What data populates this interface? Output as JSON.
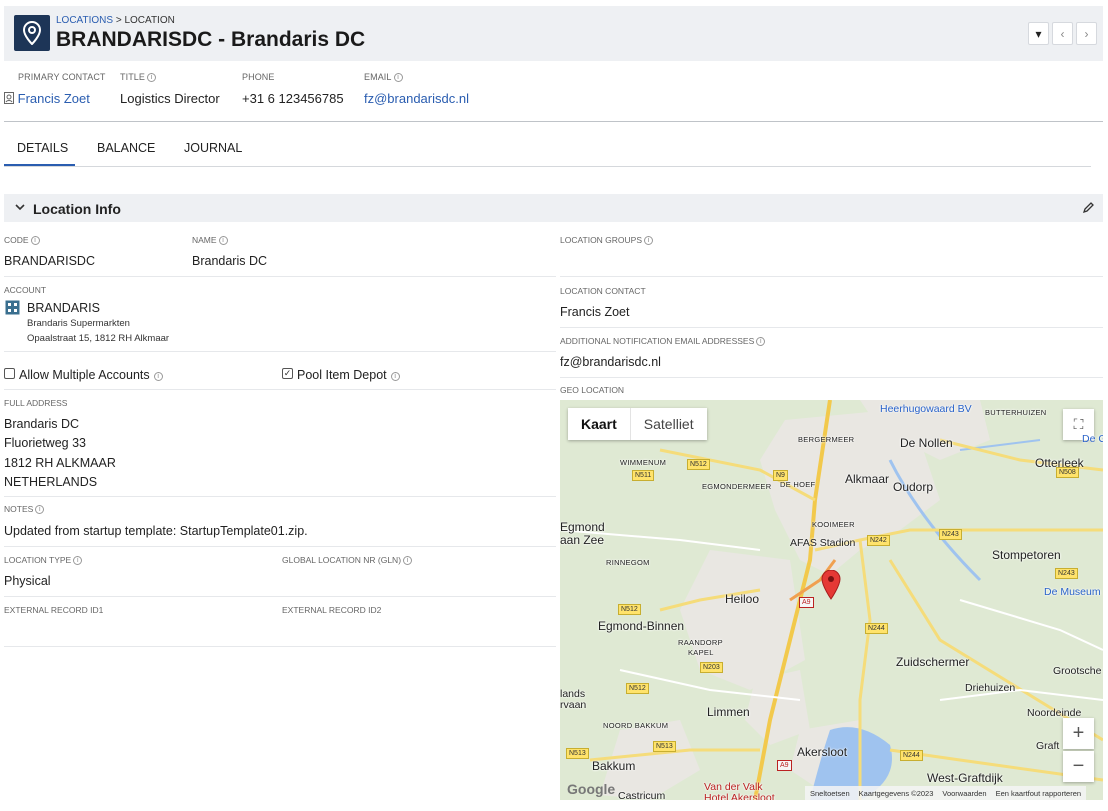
{
  "header": {
    "breadcrumb_link": "LOCATIONS",
    "breadcrumb_sep": " > ",
    "breadcrumb_current": "LOCATION",
    "title": "BRANDARISDC - Brandaris DC",
    "icon": "location-pin-icon"
  },
  "contact": {
    "primary_contact_label": "PRIMARY CONTACT",
    "primary_contact_value": "Francis Zoet",
    "title_label": "TITLE",
    "title_value": "Logistics Director",
    "phone_label": "PHONE",
    "phone_value": "+31 6 123456785",
    "email_label": "EMAIL",
    "email_value": "fz@brandarisdc.nl"
  },
  "tabs": [
    {
      "label": "DETAILS",
      "active": true
    },
    {
      "label": "BALANCE",
      "active": false
    },
    {
      "label": "JOURNAL",
      "active": false
    }
  ],
  "section": {
    "title": "Location Info"
  },
  "fields": {
    "code_label": "CODE",
    "code_value": "BRANDARISDC",
    "name_label": "NAME",
    "name_value": "Brandaris DC",
    "location_groups_label": "LOCATION GROUPS",
    "account_label": "ACCOUNT",
    "account_code": "BRANDARIS",
    "account_name": "Brandaris Supermarkten",
    "account_address": "Opaalstraat 15, 1812 RH Alkmaar",
    "location_contact_label": "LOCATION CONTACT",
    "location_contact_value": "Francis Zoet",
    "additional_email_label": "ADDITIONAL NOTIFICATION EMAIL ADDRESSES",
    "additional_email_value": "fz@brandarisdc.nl",
    "allow_multiple_label": "Allow Multiple Accounts",
    "allow_multiple_checked": false,
    "pool_item_label": "Pool Item Depot",
    "pool_item_checked": true,
    "geo_label": "GEO LOCATION",
    "full_address_label": "FULL ADDRESS",
    "address_line1": "Brandaris DC",
    "address_line2": "Fluorietweg 33",
    "address_line3": "1812 RH  ALKMAAR",
    "address_line4": "NETHERLANDS",
    "notes_label": "NOTES",
    "notes_value": "Updated from startup template: StartupTemplate01.zip.",
    "location_type_label": "LOCATION TYPE",
    "location_type_value": "Physical",
    "gln_label": "GLOBAL LOCATION NR (GLN)",
    "ext1_label": "EXTERNAL RECORD ID1",
    "ext2_label": "EXTERNAL RECORD ID2"
  },
  "map": {
    "toggle_map": "Kaart",
    "toggle_satellite": "Satelliet",
    "places": {
      "heerhugowaard": "Heerhugowaard BV",
      "butterhuizen": "BUTTERHUIZEN",
      "bergermeer": "BERGERMEER",
      "de_nollen": "De Nollen",
      "de_g": "De G",
      "wimmenum": "WIMMENUM",
      "egmondermeer": "EGMONDERMEER",
      "de_hoef": "DE HOEF",
      "alkmaar": "Alkmaar",
      "oudorp": "Oudorp",
      "otterleek": "Otterleek",
      "egmond": "Egmond",
      "aan_zee": "aan Zee",
      "kooimeer": "KOOIMEER",
      "afas": "AFAS Stadion",
      "stompetoren": "Stompetoren",
      "rinnegom": "RINNEGOM",
      "de_museum": "De Museum",
      "heiloo": "Heiloo",
      "egmond_binnen": "Egmond-Binnen",
      "raandorp": "RAANDORP",
      "kapel": "KAPEL",
      "zuidschermer": "Zuidschermer",
      "grootsche": "Grootsche",
      "driehuizen": "Driehuizen",
      "lands": "lands",
      "rvaan": "rvaan",
      "limmen": "Limmen",
      "noordeinde": "Noordeinde",
      "noord_bakkum": "NOORD BAKKUM",
      "graft": "Graft",
      "akersloot": "Akersloot",
      "bakkum": "Bakkum",
      "west_graftdijk": "West-Graftdijk",
      "castricum": "Castricum",
      "van_der_valk": "Van der Valk",
      "hotel_akersloot": "Hotel Akersloot"
    },
    "roads": [
      "N512",
      "N511",
      "N9",
      "N508",
      "N242",
      "N243",
      "N243",
      "N512",
      "A9",
      "N244",
      "N203",
      "N512",
      "N244",
      "N513",
      "N513",
      "A9"
    ],
    "footer": [
      "Sneltoetsen",
      "Kaartgegevens ©2023",
      "Voorwaarden",
      "Een kaartfout rapporteren"
    ],
    "logo": "Google"
  }
}
